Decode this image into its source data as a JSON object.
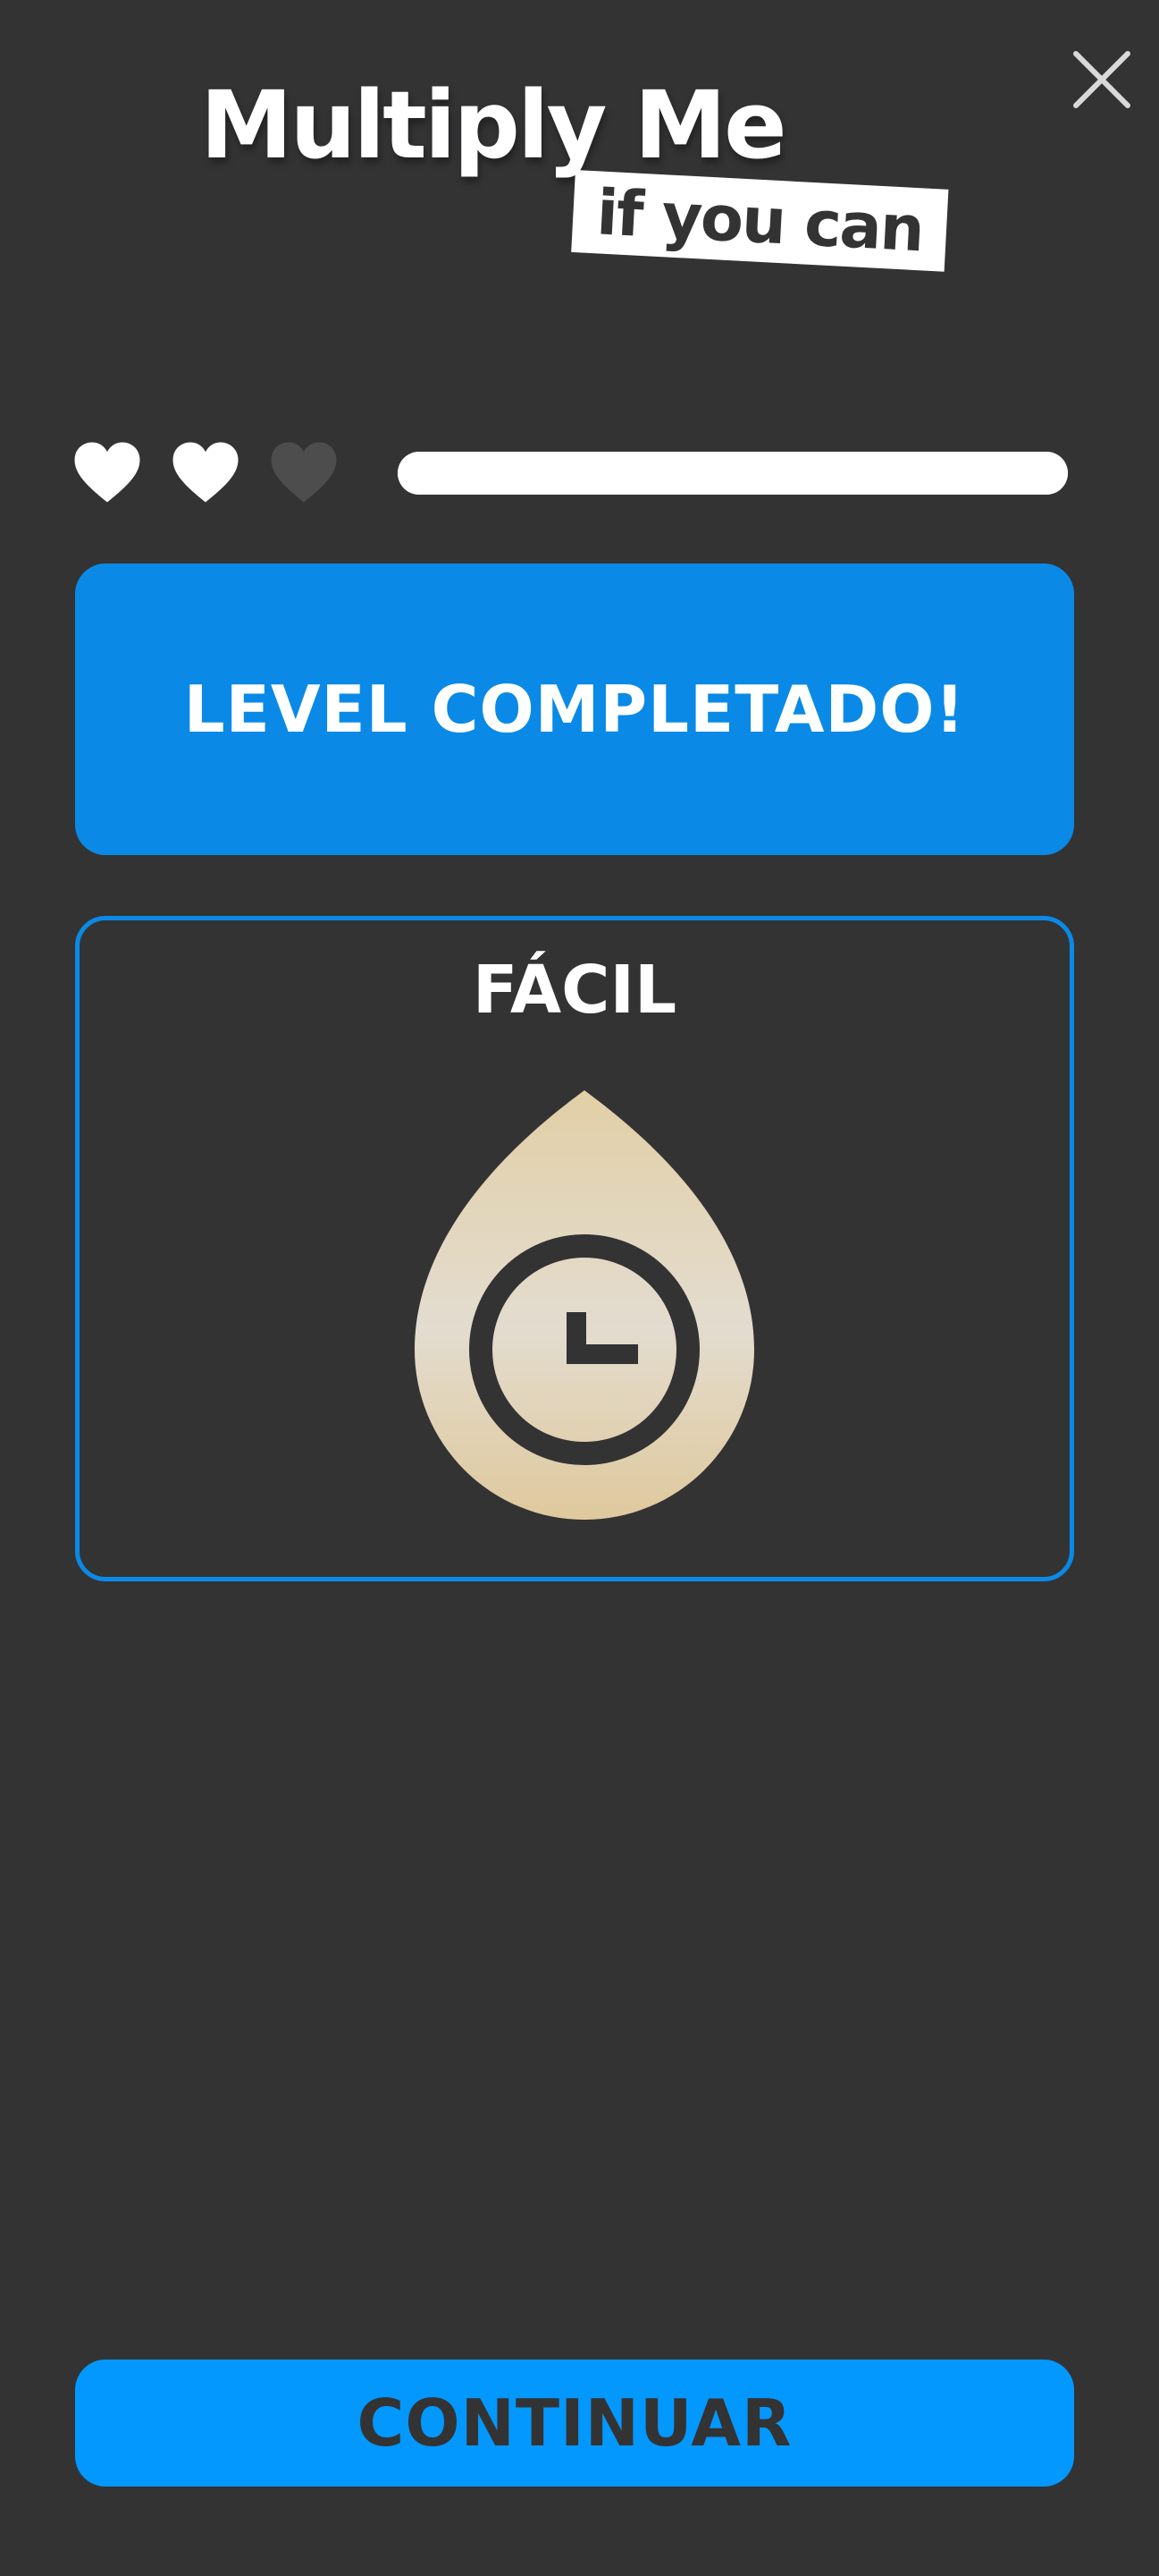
{
  "header": {
    "title": "Multiply Me",
    "tagline": "if you can",
    "close_icon": "close-icon"
  },
  "status": {
    "lives_total": 3,
    "lives_remaining": 2,
    "heart_icon": "heart-icon",
    "progress_fraction": 1.0
  },
  "banner": {
    "text": "LEVEL COMPLETADO!"
  },
  "difficulty_card": {
    "title": "FÁCIL",
    "badge_icon": "timer-badge-icon"
  },
  "footer": {
    "continue_label": "CONTINUAR"
  },
  "colors": {
    "background": "#333334",
    "accent_blue": "#0a8ae6",
    "button_blue": "#0398fe",
    "heart_full": "#ffffff",
    "heart_empty": "#4d4d4e",
    "badge_gold": "#e3d1ac"
  }
}
